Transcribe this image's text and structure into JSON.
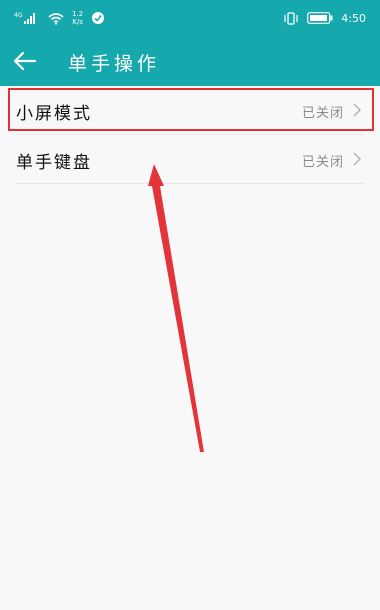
{
  "status_bar": {
    "signal_label": "4G",
    "net_speed_value": "1.2",
    "net_speed_unit": "K/s",
    "time": "4:50",
    "icons": [
      "signal-icon",
      "wifi-icon",
      "app-notification-icon",
      "vibrate-icon",
      "battery-icon"
    ]
  },
  "header": {
    "title": "单手操作",
    "back_icon": "arrow-left-icon"
  },
  "settings": [
    {
      "label": "小屏模式",
      "value": "已关闭"
    },
    {
      "label": "单手键盘",
      "value": "已关闭"
    }
  ],
  "colors": {
    "header_bg": "#15a8ad",
    "highlight": "#e0322e",
    "background": "#f8f8f8"
  }
}
